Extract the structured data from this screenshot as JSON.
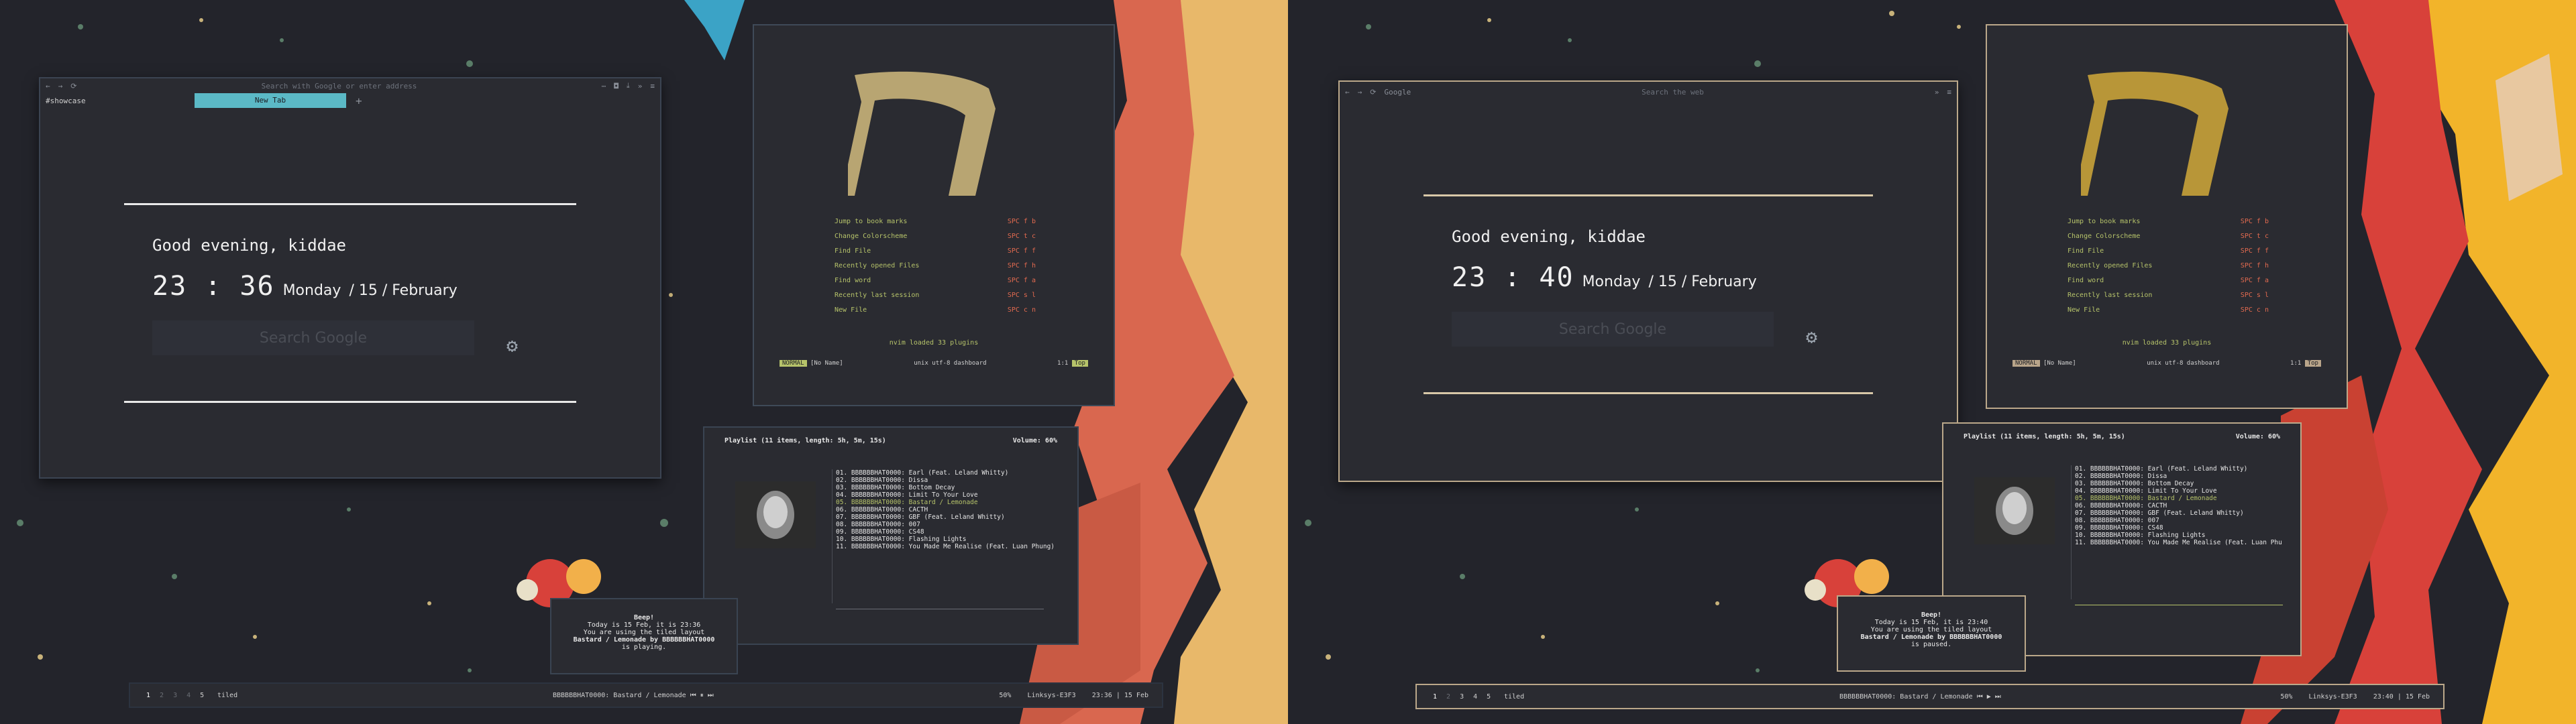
{
  "left": {
    "browser": {
      "url_placeholder": "Search with Google or enter address",
      "bookmark": "#showcase",
      "tab": "New Tab",
      "tab_plus": "+",
      "greeting": "Good evening, kiddae",
      "clock": "23 : 36",
      "date_day": "Monday",
      "date_rest": "/ 15 / February",
      "search": "Search Google"
    },
    "vim": {
      "menu": [
        {
          "label": "Jump to book marks",
          "key": "SPC f b"
        },
        {
          "label": "Change Colorscheme",
          "key": "SPC t c"
        },
        {
          "label": "Find  File",
          "key": "SPC f f"
        },
        {
          "label": "Recently opened Files",
          "key": "SPC f h"
        },
        {
          "label": "Find  word",
          "key": "SPC f a"
        },
        {
          "label": "Recently last session",
          "key": "SPC s l"
        },
        {
          "label": "New  File",
          "key": "SPC c n"
        }
      ],
      "loaded": "nvim loaded 33 plugins",
      "mode": "NORMAL",
      "noname": "[No Name]",
      "fileinfo": "unix  utf-8  dashboard",
      "pos": "1:1",
      "pct": "Top"
    },
    "playlist": {
      "header": "Playlist (11 items, length: 5h, 5m, 15s)",
      "volume": "Volume: 60%",
      "items": [
        "01. BBBBBBHAT0000: Earl (Feat. Leland Whitty)",
        "02. BBBBBBHAT0000: Dissa",
        "03. BBBBBBHAT0000: Bottom Decay",
        "04. BBBBBBHAT0000: Limit To Your Love",
        "05. BBBBBBHAT0000: Bastard / Lemonade",
        "06. BBBBBBHAT0000: CACTH",
        "07. BBBBBBHAT0000: GBF (Feat. Leland Whitty)",
        "08. BBBBBBHAT0000: 007",
        "09. BBBBBBHAT0000: CS48",
        "10. BBBBBBHAT0000: Flashing Lights",
        "11. BBBBBBHAT0000: You Made Me Realise (Feat. Luan Phung)"
      ]
    },
    "notif": {
      "title": "Beep!",
      "line1": "Today is 15 Feb, it is 23:36",
      "line2": "You are using the tiled layout",
      "line3": "Bastard / Lemonade by BBBBBBHAT0000",
      "line4": "is playing."
    },
    "bar": {
      "workspaces": [
        "1",
        "2",
        "3",
        "4",
        "5"
      ],
      "layout": "tiled",
      "nowplaying": "BBBBBBHAT0000: Bastard / Lemonade  ⏮ ⏸ ⏭",
      "volume": "50%",
      "net": "Linksys-E3F3",
      "datetime": "23:36 | 15 Feb"
    }
  },
  "right": {
    "browser": {
      "home_title": "Google",
      "url_placeholder": "Search the web",
      "greeting": "Good evening, kiddae",
      "clock": "23 : 40",
      "date_day": "Monday",
      "date_rest": "/ 15 / February",
      "search": "Search Google"
    },
    "vim": {
      "menu": [
        {
          "label": "Jump to book marks",
          "key": "SPC f b"
        },
        {
          "label": "Change Colorscheme",
          "key": "SPC t c"
        },
        {
          "label": "Find  File",
          "key": "SPC f f"
        },
        {
          "label": "Recently opened Files",
          "key": "SPC f h"
        },
        {
          "label": "Find  word",
          "key": "SPC f a"
        },
        {
          "label": "Recently last session",
          "key": "SPC s l"
        },
        {
          "label": "New  File",
          "key": "SPC c n"
        }
      ],
      "loaded": "nvim loaded 33 plugins",
      "mode": "NORMAL",
      "noname": "[No Name]",
      "fileinfo": "unix  utf-8  dashboard",
      "pos": "1:1",
      "pct": "Top"
    },
    "playlist": {
      "header": "Playlist (11 items, length: 5h, 5m, 15s)",
      "volume": "Volume: 60%",
      "items": [
        "01. BBBBBBHAT0000: Earl (Feat. Leland Whitty)",
        "02. BBBBBBHAT0000: Dissa",
        "03. BBBBBBHAT0000: Bottom Decay",
        "04. BBBBBBHAT0000: Limit To Your Love",
        "05. BBBBBBHAT0000: Bastard / Lemonade",
        "06. BBBBBBHAT0000: CACTH",
        "07. BBBBBBHAT0000: GBF (Feat. Leland Whitty)",
        "08. BBBBBBHAT0000: 007",
        "09. BBBBBBHAT0000: CS48",
        "10. BBBBBBHAT0000: Flashing Lights",
        "11. BBBBBBHAT0000: You Made Me Realise (Feat. Luan Phu"
      ]
    },
    "notif": {
      "title": "Beep!",
      "line1": "Today is 15 Feb, it is 23:40",
      "line2": "You are using the tiled layout",
      "line3": "Bastard / Lemonade by BBBBBBHAT0000",
      "line4": "is paused."
    },
    "bar": {
      "workspaces": [
        "1",
        "2",
        "3",
        "4",
        "5"
      ],
      "layout": "tiled",
      "nowplaying": "BBBBBBHAT0000: Bastard / Lemonade  ⏮ ▶ ⏭",
      "volume": "50%",
      "net": "Linksys-E3F3",
      "datetime": "23:40 | 15 Feb"
    }
  },
  "colors": {
    "accent_cyan": "#5bb9c6",
    "border_gold": "#bba88a",
    "menu_green": "#b6c36a",
    "key_red": "#e26a4f"
  }
}
